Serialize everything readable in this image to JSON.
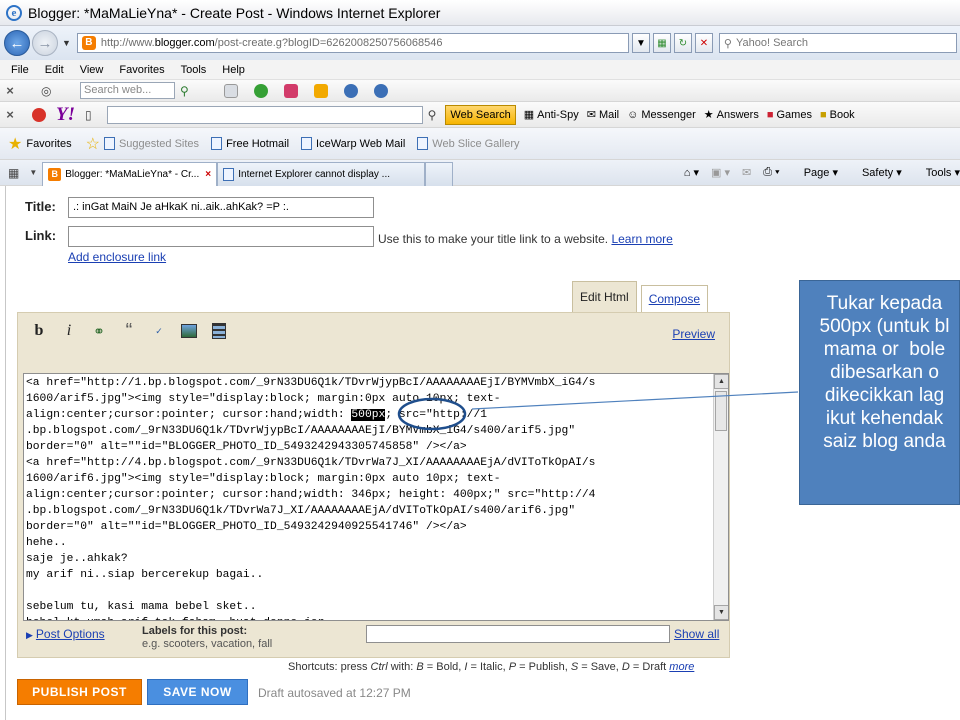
{
  "window": {
    "title": "Blogger: *MaMaLieYna* - Create Post - Windows Internet Explorer"
  },
  "address": {
    "url_prefix": "http://www.",
    "url_domain": "blogger.com",
    "url_rest": "/post-create.g?blogID=6262008250756068546",
    "search_placeholder": "Yahoo! Search"
  },
  "menu": [
    "File",
    "Edit",
    "View",
    "Favorites",
    "Tools",
    "Help"
  ],
  "toolbar1": {
    "search_placeholder": "Search web..."
  },
  "toolbar2": {
    "web_search": "Web Search",
    "links": [
      "Anti-Spy",
      "Mail",
      "Messenger",
      "Answers",
      "Games",
      "Book"
    ]
  },
  "favorites_bar": {
    "favorites_label": "Favorites",
    "links": [
      {
        "label": "Suggested Sites",
        "dimmed": true
      },
      {
        "label": "Free Hotmail",
        "dimmed": false
      },
      {
        "label": "IceWarp Web Mail",
        "dimmed": false
      },
      {
        "label": "Web Slice Gallery",
        "dimmed": true
      }
    ]
  },
  "tabs": [
    {
      "label": "Blogger: *MaMaLieYna* - Cr...",
      "active": true
    },
    {
      "label": "Internet Explorer cannot display ...",
      "active": false
    }
  ],
  "command_bar": {
    "page": "Page",
    "safety": "Safety",
    "tools": "Tools"
  },
  "post": {
    "title_label": "Title:",
    "title_value": ".: inGat MaiN Je aHkaK ni..aik..ahKak? =P :.",
    "link_label": "Link:",
    "link_value": "",
    "link_hint": "Use this to make your title link to a website.",
    "learn_more": "Learn more",
    "add_enclosure": "Add enclosure link"
  },
  "editor": {
    "tab_edit_html": "Edit Html",
    "tab_compose": "Compose",
    "preview": "Preview",
    "toolbar_icons": [
      "bold-icon",
      "italic-icon",
      "link-icon",
      "quote-icon",
      "spellcheck-icon",
      "image-icon",
      "video-icon"
    ],
    "code_before_highlight": "<a href=\"http://1.bp.blogspot.com/_9rN33DU6Q1k/TDvrWjypBcI/AAAAAAAAEjI/BYMVmbX_iG4/s\n1600/arif5.jpg\"><img style=\"display:block; margin:0px auto 10px; text-\nalign:center;cursor:pointer; cursor:hand;width: ",
    "code_highlight": "500px",
    "code_after_highlight": "; src=\"http://1\n.bp.blogspot.com/_9rN33DU6Q1k/TDvrWjypBcI/AAAAAAAAEjI/BYMVmbX_iG4/s400/arif5.jpg\"\nborder=\"0\" alt=\"\"id=\"BLOGGER_PHOTO_ID_5493242943305745858\" /></a>\n<a href=\"http://4.bp.blogspot.com/_9rN33DU6Q1k/TDvrWa7J_XI/AAAAAAAAEjA/dVIToTkOpAI/s\n1600/arif6.jpg\"><img style=\"display:block; margin:0px auto 10px; text-\nalign:center;cursor:pointer; cursor:hand;width: 346px; height: 400px;\" src=\"http://4\n.bp.blogspot.com/_9rN33DU6Q1k/TDvrWa7J_XI/AAAAAAAAEjA/dVIToTkOpAI/s400/arif6.jpg\"\nborder=\"0\" alt=\"\"id=\"BLOGGER_PHOTO_ID_5493242940925541746\" /></a>\nhehe..\nsaje je..ahkak?\nmy arif ni..siap bercerekup bagai..\n\nsebelum tu, kasi mama bebel sket..\nbebel kt umah arif tak faham, buat donno jer",
    "post_options": "Post Options",
    "labels_label": "Labels for this post:",
    "labels_example": "e.g. scooters, vacation, fall",
    "labels_value": "",
    "show_all": "Show all"
  },
  "shortcuts": {
    "prefix": "Shortcuts: press ",
    "ctrl": "Ctrl",
    "with": " with: ",
    "b": "B",
    "bold": " = Bold, ",
    "i": "I",
    "italic": " = Italic, ",
    "p": "P",
    "publish": " = Publish, ",
    "s": "S",
    "save": " = Save, ",
    "d": "D",
    "draft": " = Draft ",
    "more": "more"
  },
  "actions": {
    "publish": "PUBLISH POST",
    "save": "SAVE NOW",
    "autosave": "Draft autosaved at 12:27 PM"
  },
  "annotation": {
    "callout_lines": [
      "Tukar kepada",
      "500px (untuk bl",
      "mama or  bole",
      "dibesarkan o",
      "dikecikkan lag",
      "ikut kehendak",
      "saiz blog anda"
    ],
    "callout_color": "#4f81bd"
  },
  "colors": {
    "blogger_orange": "#f57d00",
    "save_blue": "#4a8fe0",
    "editor_bg": "#ece6d3",
    "link_blue": "#1a3fb3"
  }
}
